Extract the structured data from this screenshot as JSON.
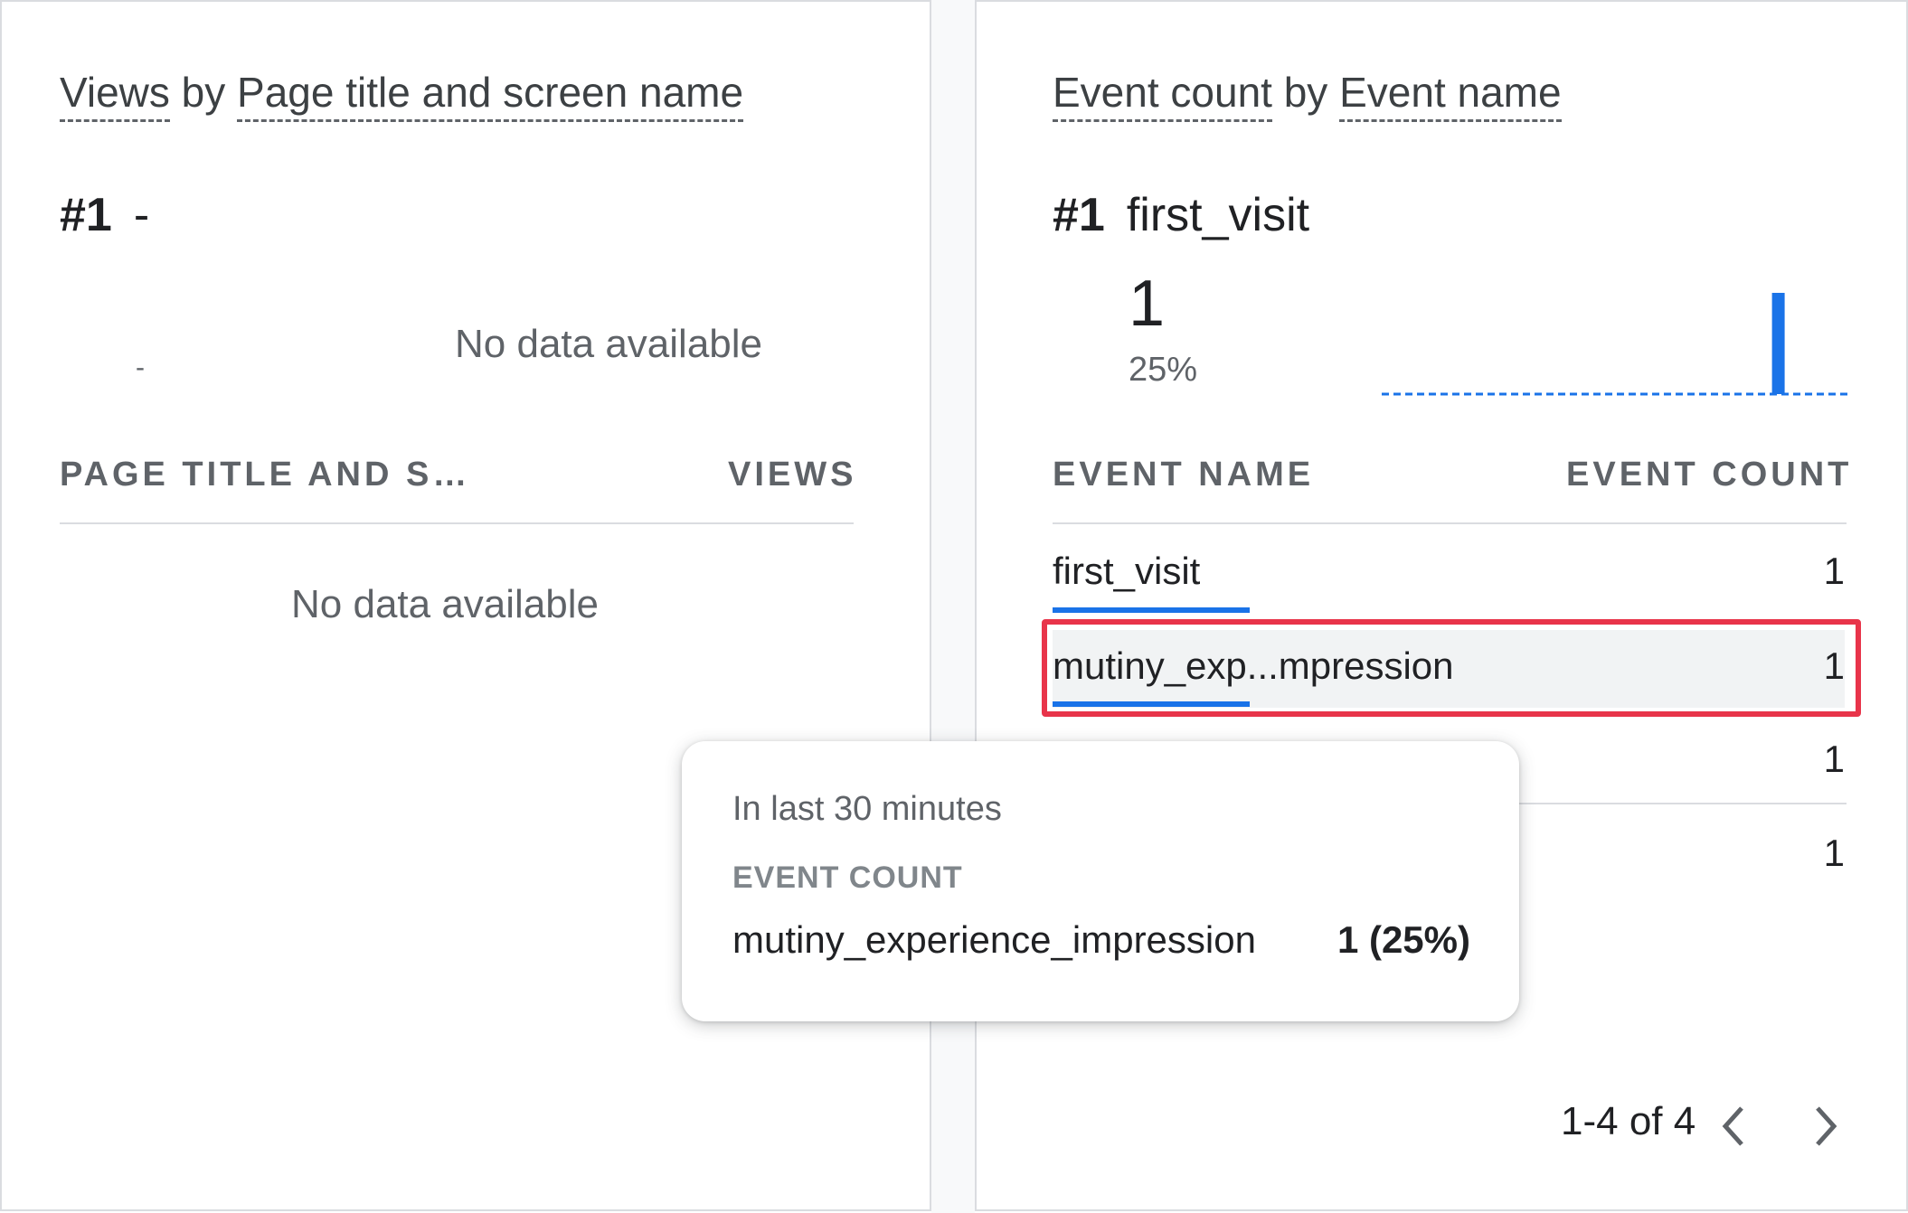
{
  "left_card": {
    "title_prefix": "Views",
    "title_by": "by",
    "title_dimension": "Page title and screen name",
    "rank_number": "#1",
    "rank_value": "-",
    "spark_value": "-",
    "no_data_chart": "No data available",
    "col_dimension": "PAGE TITLE AND S…",
    "col_metric": "VIEWS",
    "no_data_table": "No data available"
  },
  "right_card": {
    "title_prefix": "Event count",
    "title_by": "by",
    "title_dimension": "Event name",
    "rank_number": "#1",
    "rank_value": "first_visit",
    "top_value": "1",
    "top_percent": "25%",
    "col_dimension": "EVENT NAME",
    "col_metric": "EVENT COUNT",
    "rows": [
      {
        "name": "first_visit",
        "value": "1",
        "share": 0.25
      },
      {
        "name": "mutiny_exp...mpression",
        "value": "1",
        "share": 0.25
      },
      {
        "name": "",
        "value": "1",
        "share": 0.25
      },
      {
        "name": "",
        "value": "1",
        "share": 0.25
      }
    ],
    "pagination": "1-4 of 4"
  },
  "tooltip": {
    "period": "In last 30 minutes",
    "metric": "EVENT COUNT",
    "name": "mutiny_experience_impression",
    "value": "1 (25%)"
  },
  "colors": {
    "accent": "#1a73e8",
    "highlight": "#e8344a",
    "muted_text": "#5f6368"
  },
  "icons": {
    "prev": "chevron-left-icon",
    "next": "chevron-right-icon"
  },
  "chart_data": {
    "type": "bar",
    "x": [
      0,
      1,
      2,
      3,
      4,
      5,
      6,
      7,
      8,
      9,
      10,
      11,
      12,
      13,
      14,
      15,
      16,
      17,
      18,
      19,
      20,
      21,
      22,
      23,
      24,
      25,
      26,
      27,
      28,
      29
    ],
    "values": [
      0,
      0,
      0,
      0,
      0,
      0,
      0,
      0,
      0,
      0,
      0,
      0,
      0,
      0,
      0,
      0,
      0,
      0,
      0,
      0,
      0,
      0,
      0,
      0,
      0,
      1,
      0,
      0,
      0,
      0
    ],
    "ylim": [
      0,
      1
    ]
  }
}
